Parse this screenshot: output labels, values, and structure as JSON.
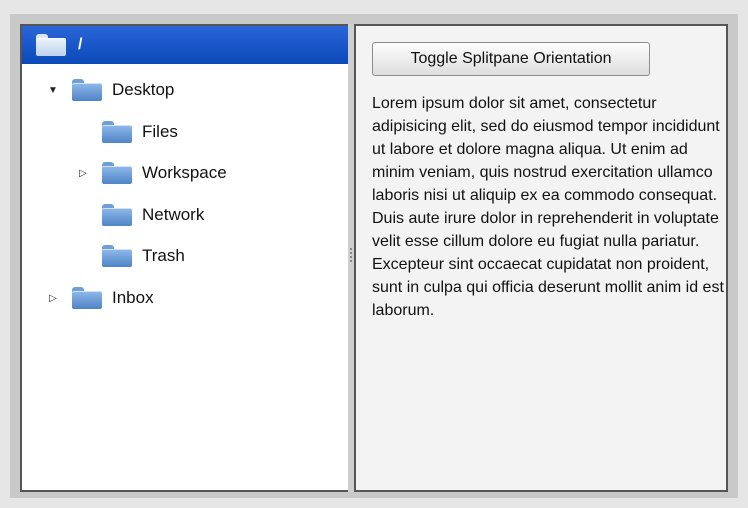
{
  "tree": {
    "root": {
      "label": "/"
    },
    "items": [
      {
        "label": "Desktop",
        "expander": "expanded"
      },
      {
        "label": "Files",
        "expander": "none"
      },
      {
        "label": "Workspace",
        "expander": "collapsed"
      },
      {
        "label": "Network",
        "expander": "none"
      },
      {
        "label": "Trash",
        "expander": "none"
      },
      {
        "label": "Inbox",
        "expander": "collapsed"
      }
    ]
  },
  "right_pane": {
    "toggle_button_label": "Toggle Splitpane Orientation",
    "body_text": "Lorem ipsum dolor sit amet, consectetur adipisicing elit, sed do eiusmod tempor incididunt ut labore et dolore magna aliqua. Ut enim ad minim veniam, quis nostrud exercitation ullamco laboris nisi ut aliquip ex ea commodo consequat. Duis aute irure dolor in reprehenderit in voluptate velit esse cillum dolore eu fugiat nulla pariatur. Excepteur sint occaecat cupidatat non proident, sunt in culpa qui officia deserunt mollit anim id est laborum."
  },
  "colors": {
    "selection": "#0b48b8",
    "folder": "#4f84c6",
    "right_pane_bg": "#f3f3f3"
  }
}
